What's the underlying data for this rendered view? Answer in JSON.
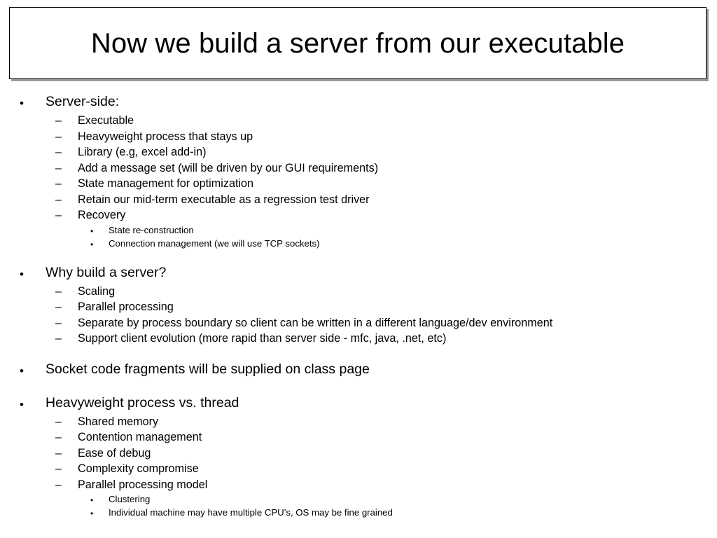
{
  "slide": {
    "title": "Now we build a server from our executable",
    "background_color": "#ffffff",
    "text_color": "#000000",
    "title_border_color": "#000000",
    "title_shadow_color": "#9a9a9a",
    "bullet_markers": {
      "level1": "•",
      "level2": "–",
      "level3": "•"
    },
    "outline": [
      {
        "level": 1,
        "text": "Server-side:"
      },
      {
        "level": 2,
        "text": "Executable"
      },
      {
        "level": 2,
        "text": "Heavyweight process that stays up"
      },
      {
        "level": 2,
        "text": "Library (e.g, excel add-in)"
      },
      {
        "level": 2,
        "text": "Add a message set (will be driven by our GUI requirements)"
      },
      {
        "level": 2,
        "text": "State management for optimization"
      },
      {
        "level": 2,
        "text": "Retain our mid-term executable as a regression test driver"
      },
      {
        "level": 2,
        "text": "Recovery"
      },
      {
        "level": 3,
        "text": "State re-construction"
      },
      {
        "level": 3,
        "text": "Connection management (we will use TCP sockets)"
      },
      {
        "level": 0,
        "text": ""
      },
      {
        "level": 1,
        "text": "Why build a server?"
      },
      {
        "level": 2,
        "text": "Scaling"
      },
      {
        "level": 2,
        "text": "Parallel processing"
      },
      {
        "level": 2,
        "text": "Separate by process boundary so client can be written in a different language/dev environment"
      },
      {
        "level": 2,
        "text": "Support client evolution (more rapid than server side - mfc, java, .net, etc)"
      },
      {
        "level": 0,
        "text": ""
      },
      {
        "level": 1,
        "text": "Socket code fragments will be supplied on class page"
      },
      {
        "level": 0,
        "text": ""
      },
      {
        "level": 1,
        "text": "Heavyweight process vs. thread"
      },
      {
        "level": 2,
        "text": "Shared memory"
      },
      {
        "level": 2,
        "text": "Contention management"
      },
      {
        "level": 2,
        "text": "Ease of debug"
      },
      {
        "level": 2,
        "text": "Complexity compromise"
      },
      {
        "level": 2,
        "text": "Parallel processing model"
      },
      {
        "level": 3,
        "text": "Clustering"
      },
      {
        "level": 3,
        "text": "Individual machine may have multiple CPU’s, OS may be fine grained"
      }
    ]
  }
}
